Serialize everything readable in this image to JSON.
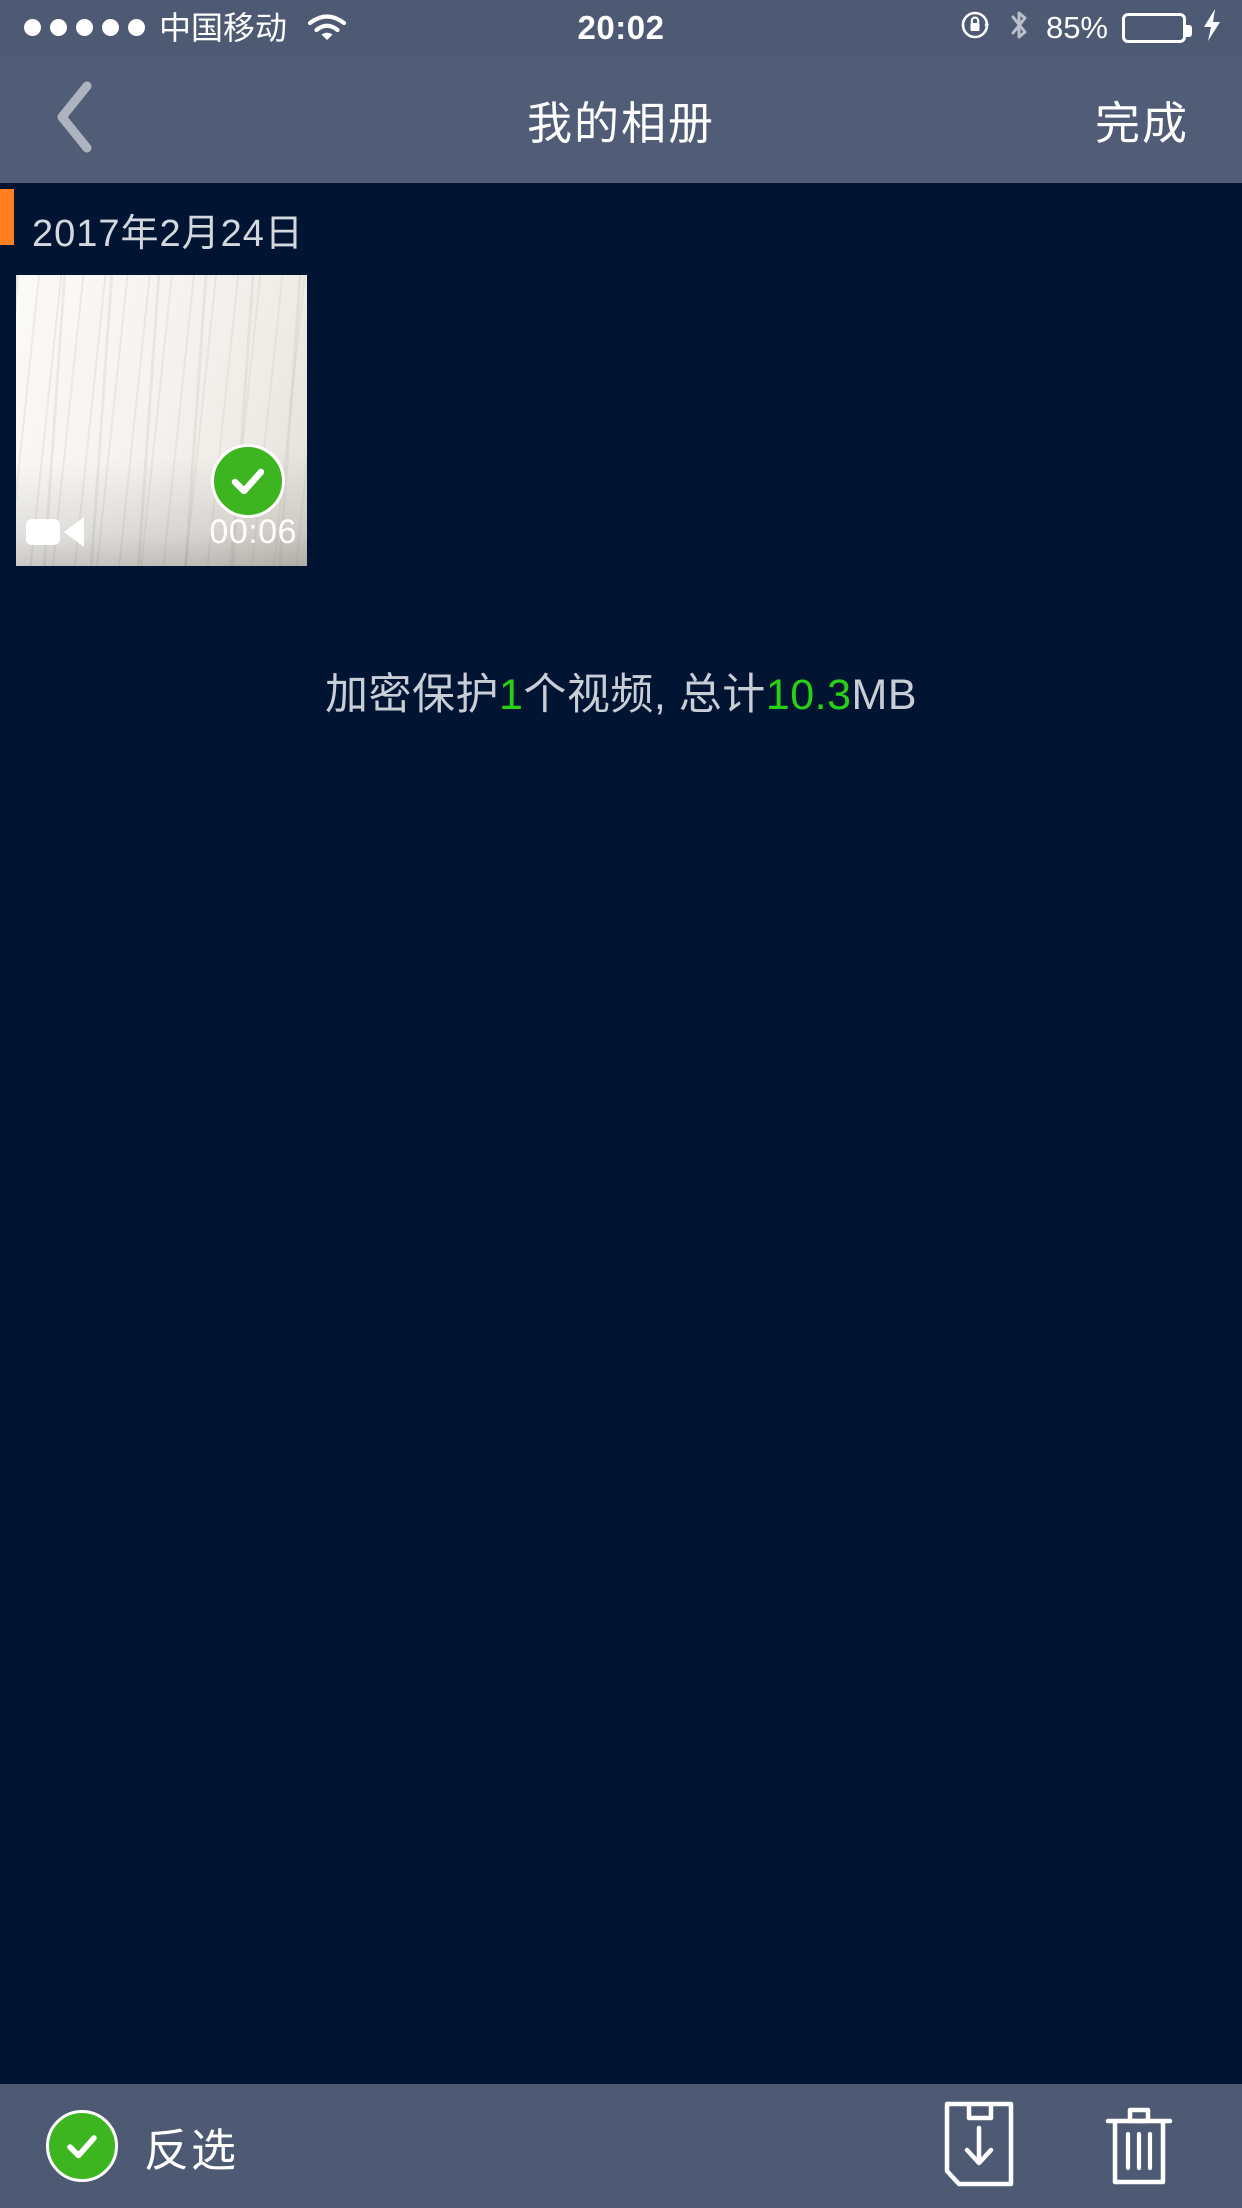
{
  "status_bar": {
    "signal_dots": 5,
    "carrier": "中国移动",
    "wifi_icon": "wifi-icon",
    "time": "20:02",
    "rotation_lock_icon": "rotation-lock-icon",
    "bluetooth_icon": "bluetooth-icon",
    "battery_percent": "85%",
    "battery_level": 85,
    "charging_icon": "lightning-bolt-icon",
    "battery_color": "#4cd662"
  },
  "nav_bar": {
    "back_icon": "chevron-left-icon",
    "title": "我的相册",
    "done_label": "完成"
  },
  "content": {
    "section": {
      "date": "2017年2月24日",
      "marker_color": "#ff7f22"
    },
    "items": [
      {
        "type": "video",
        "duration": "00:06",
        "selected": true,
        "video_icon": "video-camera-icon",
        "check_icon": "check-circle-icon"
      }
    ],
    "summary": {
      "prefix": "加密保护",
      "count": "1",
      "middle": "个视频, 总计",
      "size": "10.3",
      "suffix": "MB",
      "highlight_color": "#27d116"
    }
  },
  "toolbar": {
    "invert_label": "反选",
    "invert_icon": "check-circle-icon",
    "save_icon": "save-download-icon",
    "delete_icon": "trash-icon"
  },
  "theme": {
    "background": "#011533",
    "chrome": "#4e5a73",
    "navbar": "#515d76",
    "accent_green": "#3cb521"
  }
}
